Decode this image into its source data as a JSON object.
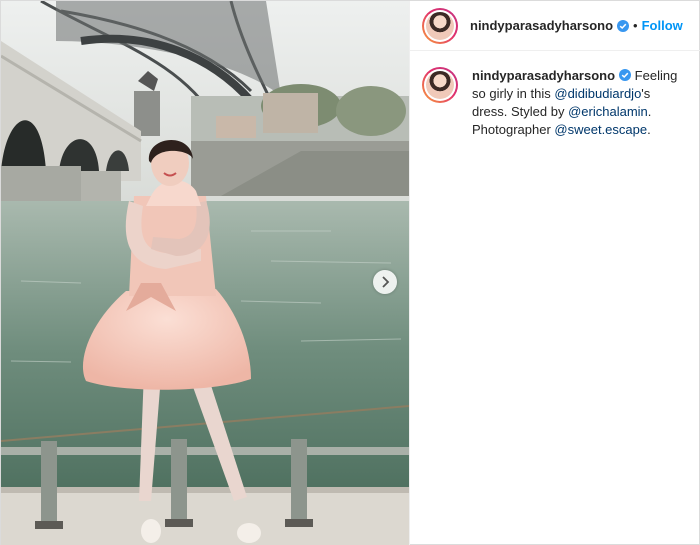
{
  "post": {
    "username": "nindyparasadyharsono",
    "follow_label": "Follow",
    "separator": "•",
    "caption": {
      "username": "nindyparasadyharsono",
      "part1": "Feeling so girly in this ",
      "mention1": "@didibudiardjo",
      "part2": "'s dress. Styled by ",
      "mention2": "@erichalamin",
      "part3": ". Photographer ",
      "mention3": "@sweet.escape",
      "part4": "."
    }
  },
  "icons": {
    "verified": "verified-badge-icon",
    "next": "chevron-right-icon"
  },
  "colors": {
    "link": "#0095f6",
    "mention": "#00376b",
    "verified": "#3897f0",
    "dress": "#f2c3b5"
  }
}
